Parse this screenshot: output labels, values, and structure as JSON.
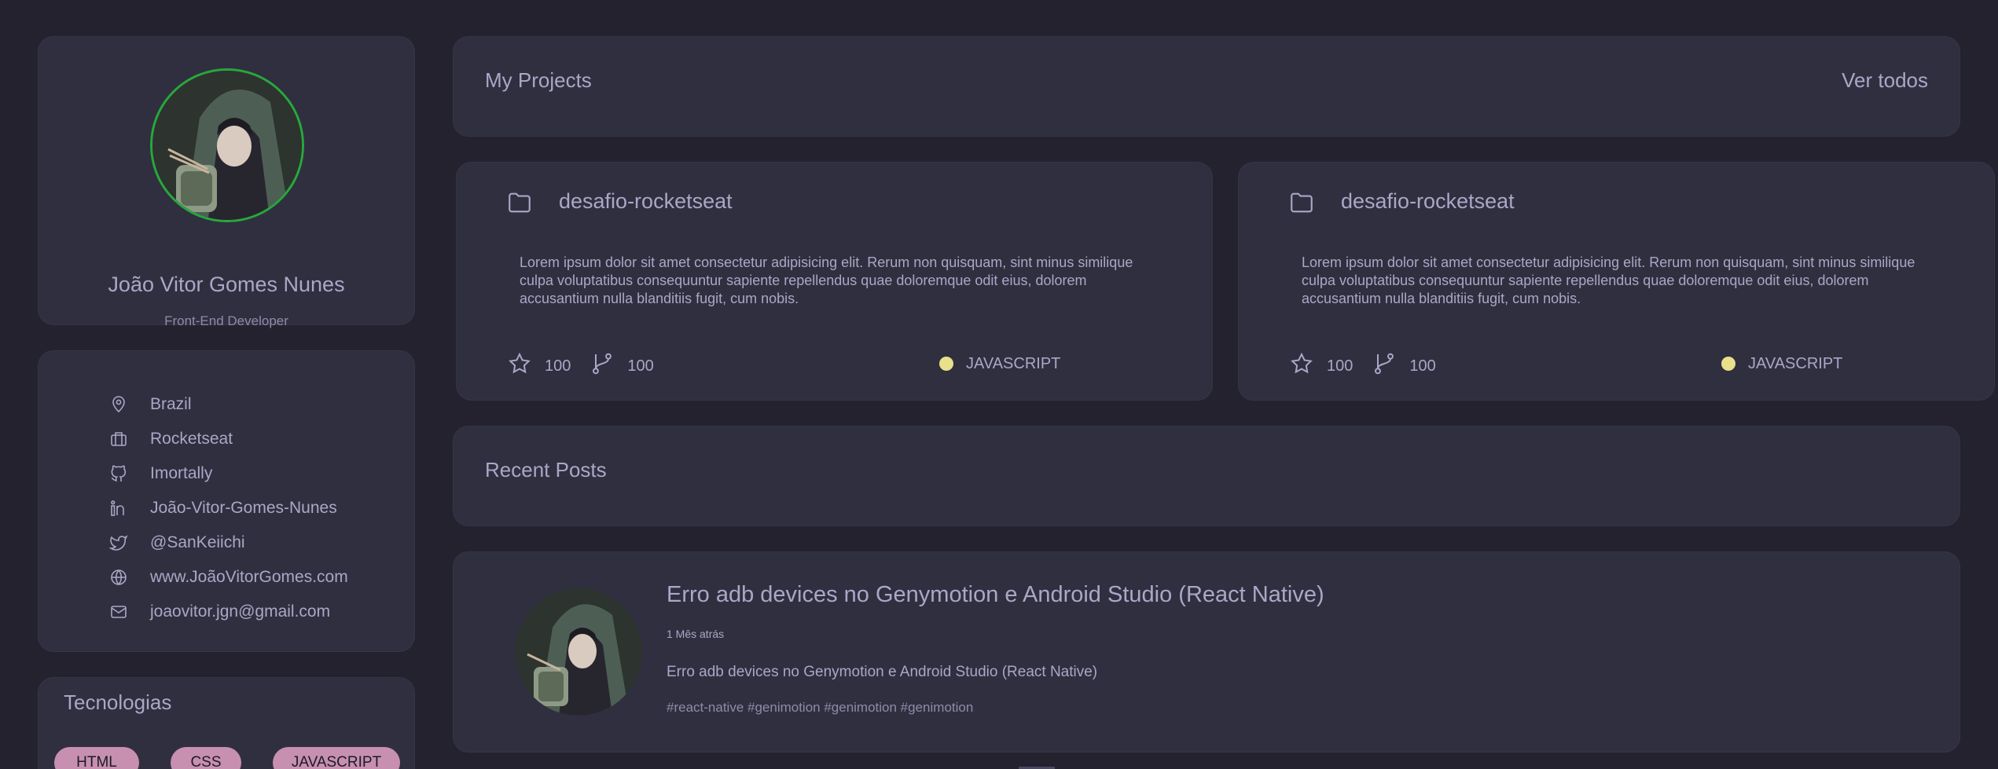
{
  "profile": {
    "name": "João Vitor Gomes Nunes",
    "role": "Front-End Developer"
  },
  "info": {
    "items": [
      {
        "icon": "location-pin-icon",
        "label": "Brazil"
      },
      {
        "icon": "briefcase-icon",
        "label": "Rocketseat"
      },
      {
        "icon": "github-icon",
        "label": "Imortally"
      },
      {
        "icon": "linkedin-icon",
        "label": "João-Vitor-Gomes-Nunes"
      },
      {
        "icon": "twitter-icon",
        "label": "@SanKeiichi"
      },
      {
        "icon": "globe-icon",
        "label": "www.JoãoVitorGomes.com"
      },
      {
        "icon": "mail-icon",
        "label": "joaovitor.jgn@gmail.com"
      }
    ]
  },
  "tech": {
    "title": "Tecnologias",
    "tags": [
      "HTML",
      "CSS",
      "JAVASCRIPT"
    ]
  },
  "projects_header": {
    "title": "My Projects",
    "link": "Ver todos"
  },
  "projects": [
    {
      "title": "desafio-rocketseat",
      "description": "Lorem ipsum dolor sit amet consectetur adipisicing elit. Rerum non quisquam, sint minus similique culpa voluptatibus consequuntur sapiente repellendus quae doloremque odit eius, dolorem accusantium nulla blanditiis fugit, cum nobis.",
      "stars": "100",
      "forks": "100",
      "language": "JAVASCRIPT"
    },
    {
      "title": "desafio-rocketseat",
      "description": "Lorem ipsum dolor sit amet consectetur adipisicing elit. Rerum non quisquam, sint minus similique culpa voluptatibus consequuntur sapiente repellendus quae doloremque odit eius, dolorem accusantium nulla blanditiis fugit, cum nobis.",
      "stars": "100",
      "forks": "100",
      "language": "JAVASCRIPT"
    }
  ],
  "posts_header": {
    "title": "Recent Posts"
  },
  "posts": [
    {
      "title": "Erro adb devices no Genymotion e Android Studio (React Native)",
      "date": "1 Mês atrás",
      "body": "Erro adb devices no Genymotion e Android Studio (React Native)",
      "tags": "#react-native #genimotion #genimotion #genimotion"
    }
  ],
  "colors": {
    "background": "#23222e",
    "card": "#302f3f",
    "text": "#aaa7c7",
    "avatar_ring": "#27a83c",
    "tag": "#c78fb0",
    "language_dot": "#e8e08a"
  }
}
